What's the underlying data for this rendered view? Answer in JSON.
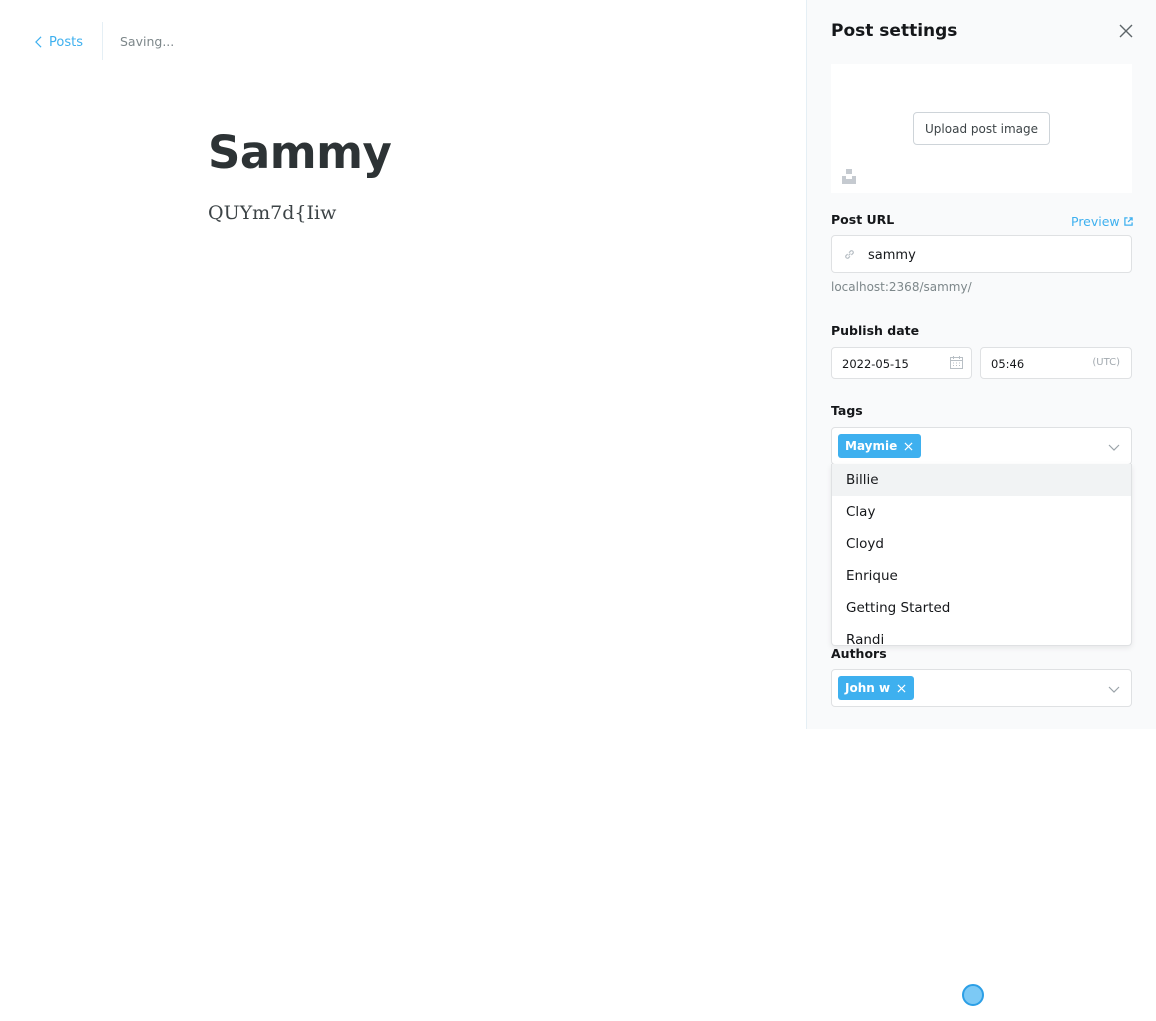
{
  "header": {
    "back_label": "Posts",
    "status": "Saving..."
  },
  "editor": {
    "title": "Sammy",
    "body": "QUYm7d{Iiw"
  },
  "settings": {
    "title": "Post settings",
    "upload_label": "Upload post image",
    "post_url": {
      "label": "Post URL",
      "preview_label": "Preview",
      "value": "sammy",
      "hint": "localhost:2368/sammy/"
    },
    "publish_date": {
      "label": "Publish date",
      "date": "2022-05-15",
      "time": "05:46",
      "timezone": "(UTC)"
    },
    "tags": {
      "label": "Tags",
      "selected": [
        "Maymie"
      ],
      "options": [
        "Billie",
        "Clay",
        "Cloyd",
        "Enrique",
        "Getting Started",
        "Randi"
      ],
      "highlighted_index": 0
    },
    "authors": {
      "label": "Authors",
      "selected": [
        "John w"
      ]
    }
  },
  "colors": {
    "accent": "#3eb0ef",
    "panel_bg": "#f9fafb",
    "text": "#15171a",
    "muted": "#7d878a"
  }
}
